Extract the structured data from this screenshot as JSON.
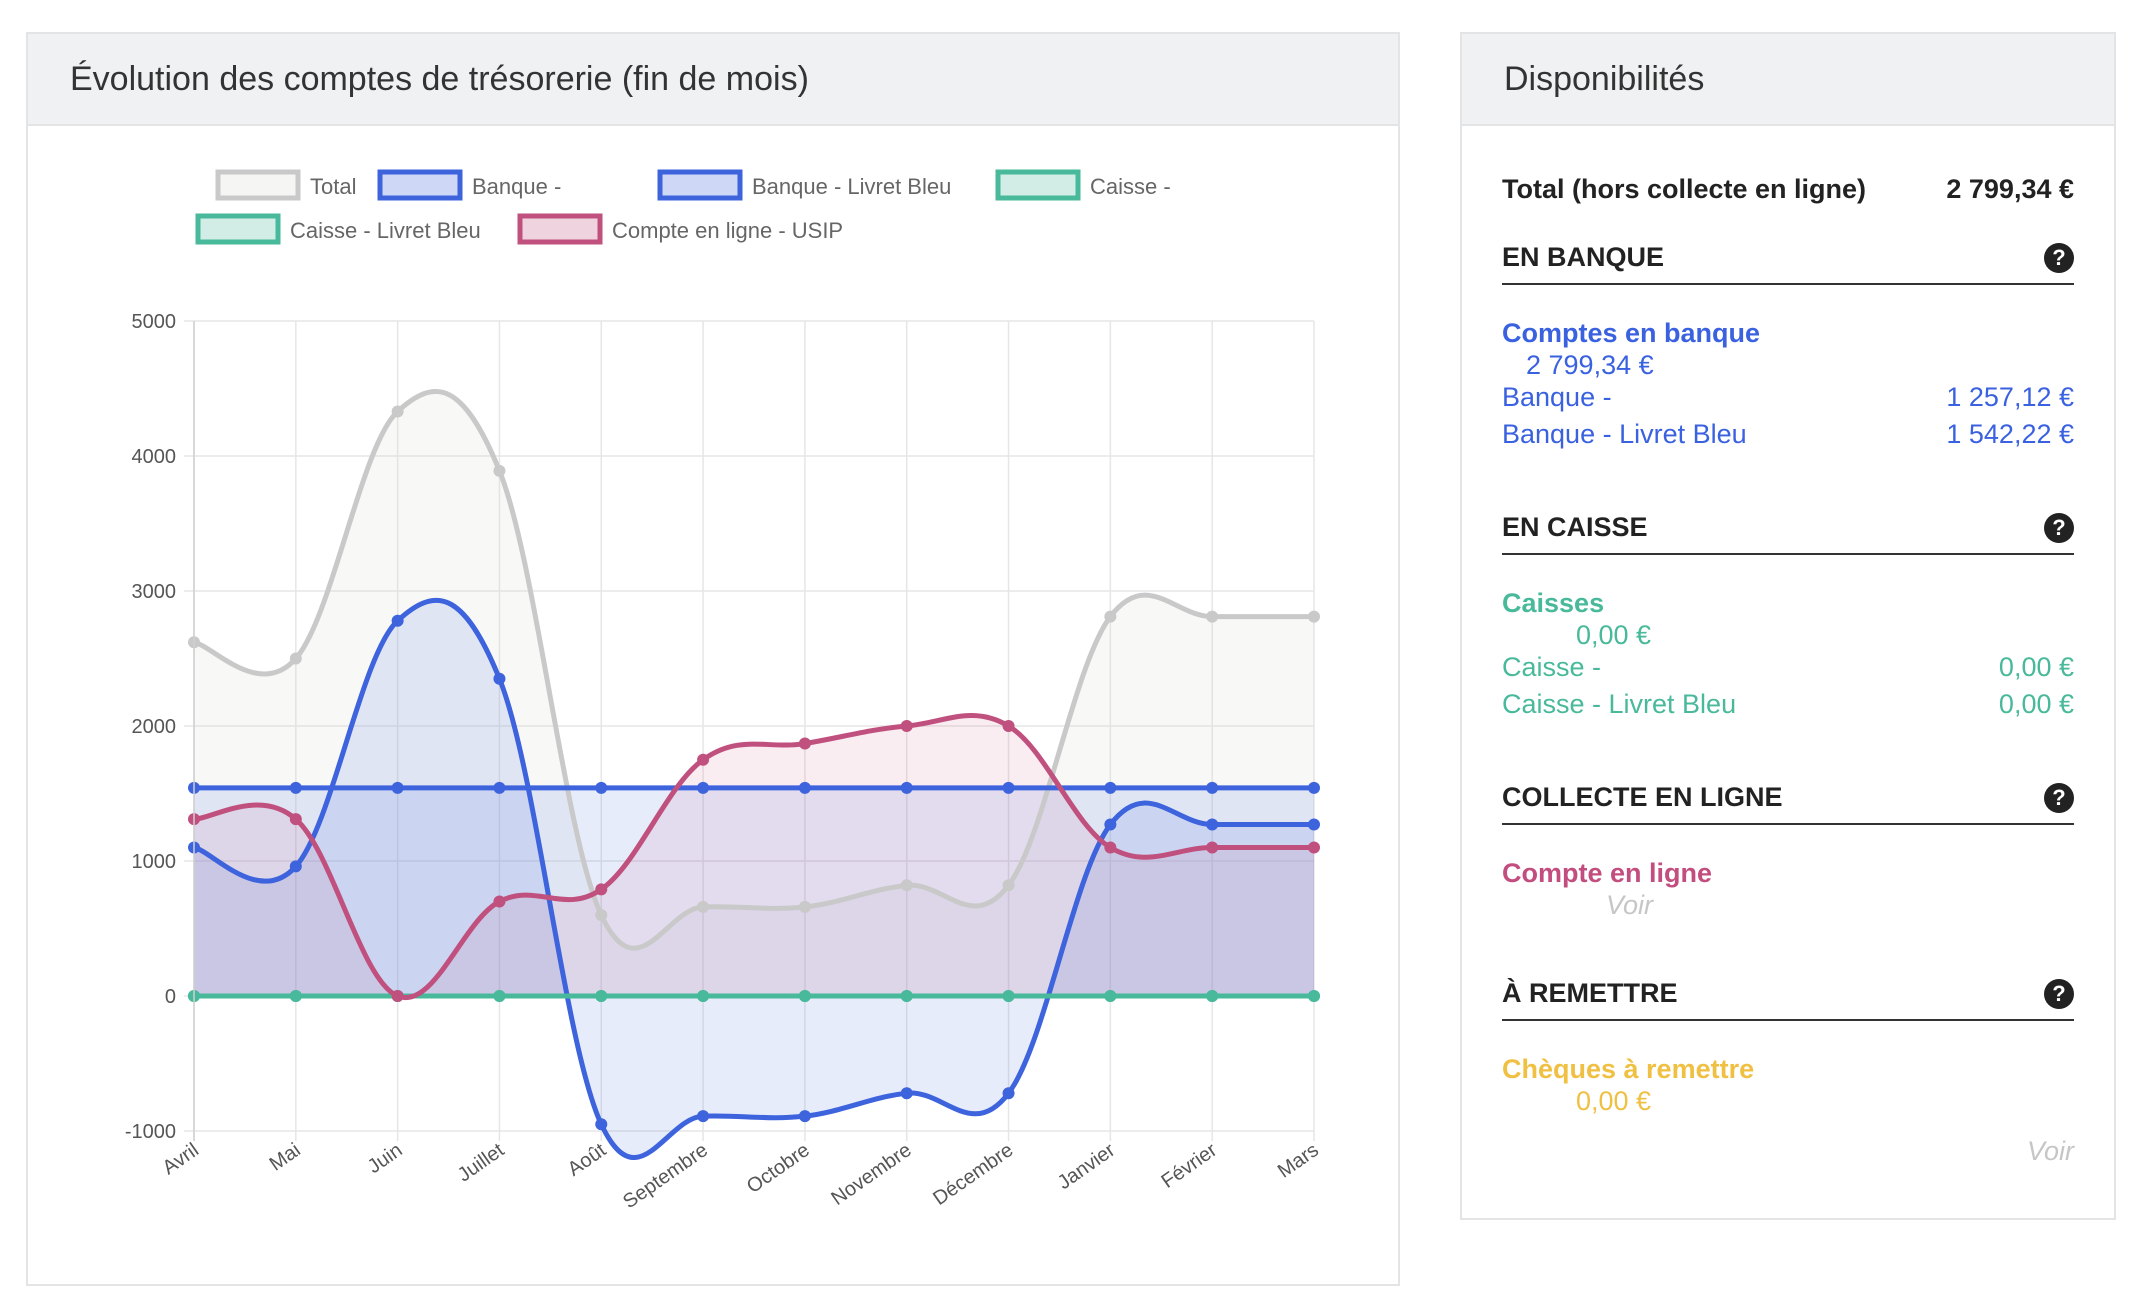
{
  "chart_panel": {
    "title": "Évolution des comptes de trésorerie (fin de mois)"
  },
  "chart_data": {
    "type": "line",
    "categories": [
      "Avril",
      "Mai",
      "Juin",
      "Juillet",
      "Août",
      "Septembre",
      "Octobre",
      "Novembre",
      "Décembre",
      "Janvier",
      "Février",
      "Mars"
    ],
    "ylim": [
      -1000,
      5000
    ],
    "yticks": [
      5000,
      4000,
      3000,
      2000,
      1000,
      0,
      -1000
    ],
    "grid": true,
    "legend_position": "top",
    "series": [
      {
        "name": "Total",
        "color": "#c9c9c9",
        "fill": "rgba(215,215,210,0.18)",
        "values": [
          2620,
          2500,
          4330,
          3890,
          600,
          660,
          660,
          820,
          820,
          2810,
          2810,
          2810
        ]
      },
      {
        "name": "Banque -",
        "color": "#3d63dd",
        "fill": "rgba(61,99,221,0.12)",
        "values": [
          1100,
          960,
          2780,
          2350,
          -950,
          -890,
          -890,
          -720,
          -720,
          1270,
          1270,
          1270
        ]
      },
      {
        "name": "Banque - Livret Bleu",
        "color": "#3d63dd",
        "fill": "rgba(61,99,221,0.12)",
        "values": [
          1542,
          1542,
          1542,
          1542,
          1542,
          1542,
          1542,
          1542,
          1542,
          1542,
          1542,
          1542
        ]
      },
      {
        "name": "Caisse -",
        "color": "#48b99a",
        "fill": "rgba(72,185,154,0.12)",
        "values": [
          0,
          0,
          0,
          0,
          0,
          0,
          0,
          0,
          0,
          0,
          0,
          0
        ]
      },
      {
        "name": "Caisse - Livret Bleu",
        "color": "#48b99a",
        "fill": "rgba(72,185,154,0.12)",
        "values": [
          0,
          0,
          0,
          0,
          0,
          0,
          0,
          0,
          0,
          0,
          0,
          0
        ]
      },
      {
        "name": "Compte en ligne - USIP",
        "color": "#c0507e",
        "fill": "rgba(192,80,126,0.10)",
        "values": [
          1310,
          1310,
          0,
          700,
          790,
          1750,
          1870,
          2000,
          2000,
          1100,
          1100,
          1100
        ]
      }
    ]
  },
  "dispo": {
    "title": "Disponibilités",
    "total_label": "Total (hors collecte en ligne)",
    "total_value": "2 799,34 €",
    "banque": {
      "title": "EN BANQUE",
      "group_label": "Comptes en banque",
      "group_value": "2 799,34 €",
      "items": [
        {
          "label": "Banque -",
          "value": "1 257,12 €"
        },
        {
          "label": "Banque - Livret Bleu",
          "value": "1 542,22 €"
        }
      ]
    },
    "caisse": {
      "title": "EN CAISSE",
      "group_label": "Caisses",
      "group_value": "0,00 €",
      "items": [
        {
          "label": "Caisse -",
          "value": "0,00 €"
        },
        {
          "label": "Caisse - Livret Bleu",
          "value": "0,00 €"
        }
      ]
    },
    "collecte": {
      "title": "COLLECTE EN LIGNE",
      "group_label": "Compte en ligne",
      "link": "Voir"
    },
    "remettre": {
      "title": "À REMETTRE",
      "group_label": "Chèques à remettre",
      "group_value": "0,00 €",
      "link": "Voir"
    },
    "help_icon": "question-circle-icon"
  }
}
